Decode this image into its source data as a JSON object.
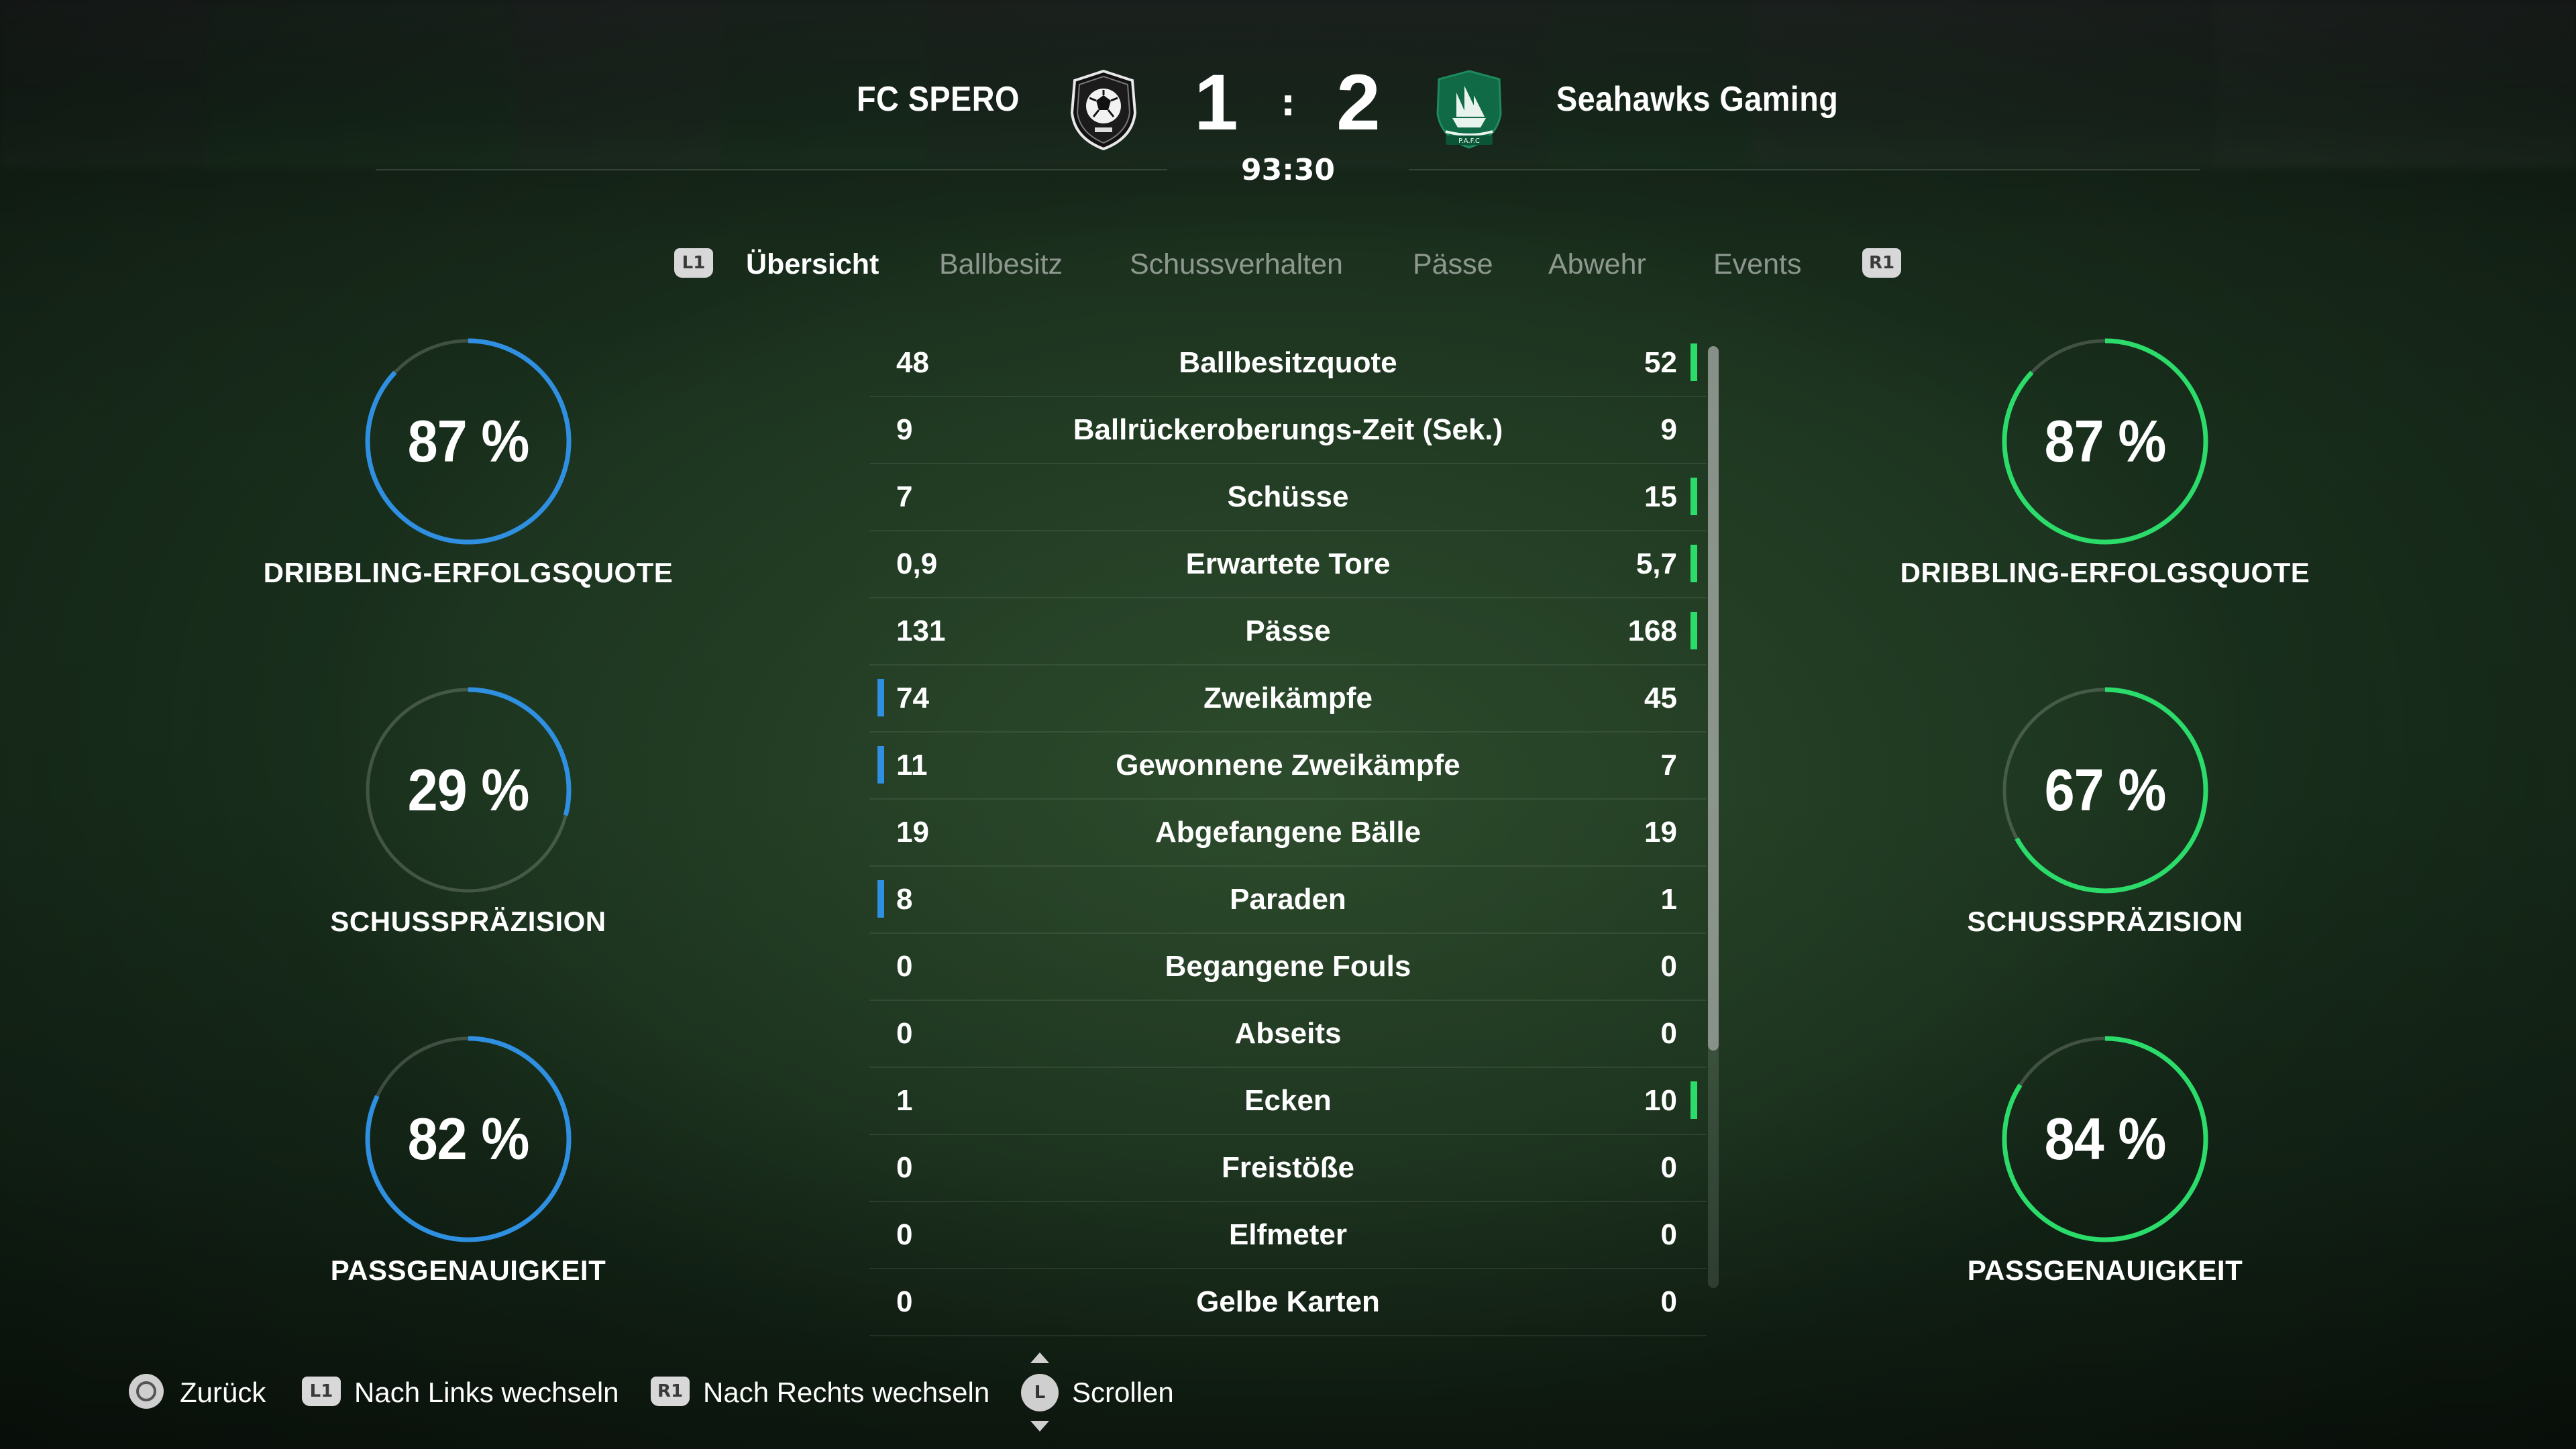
{
  "match": {
    "home_team": "FC SPERO",
    "away_team": "Seahawks Gaming",
    "home_score": "1",
    "away_score": "2",
    "separator": ":",
    "time": "93:30",
    "home_crest_icon": "club-crest-soccer-ball-icon",
    "away_crest_icon": "club-crest-ship-icon",
    "home_color": "#2f8fe0",
    "away_color": "#2bdc6a"
  },
  "tabs": {
    "left_button": "L1",
    "right_button": "R1",
    "items": [
      {
        "label": "Übersicht",
        "active": true
      },
      {
        "label": "Ballbesitz",
        "active": false
      },
      {
        "label": "Schussverhalten",
        "active": false
      },
      {
        "label": "Pässe",
        "active": false
      },
      {
        "label": "Abwehr",
        "active": false
      },
      {
        "label": "Events",
        "active": false
      }
    ]
  },
  "home_gauges": [
    {
      "value": "87 %",
      "fraction": 0.87,
      "label": "DRIBBLING-ERFOLGSQUOTE"
    },
    {
      "value": "29 %",
      "fraction": 0.29,
      "label": "SCHUSSPRÄZISION"
    },
    {
      "value": "82 %",
      "fraction": 0.82,
      "label": "PASSGENAUIGKEIT"
    }
  ],
  "away_gauges": [
    {
      "value": "87 %",
      "fraction": 0.87,
      "label": "DRIBBLING-ERFOLGSQUOTE"
    },
    {
      "value": "67 %",
      "fraction": 0.67,
      "label": "SCHUSSPRÄZISION"
    },
    {
      "value": "84 %",
      "fraction": 0.84,
      "label": "PASSGENAUIGKEIT"
    }
  ],
  "stats": [
    {
      "home": "48",
      "label": "Ballbesitzquote",
      "away": "52",
      "leader": "away"
    },
    {
      "home": "9",
      "label": "Ballrückeroberungs-Zeit (Sek.)",
      "away": "9",
      "leader": "none"
    },
    {
      "home": "7",
      "label": "Schüsse",
      "away": "15",
      "leader": "away"
    },
    {
      "home": "0,9",
      "label": "Erwartete Tore",
      "away": "5,7",
      "leader": "away"
    },
    {
      "home": "131",
      "label": "Pässe",
      "away": "168",
      "leader": "away"
    },
    {
      "home": "74",
      "label": "Zweikämpfe",
      "away": "45",
      "leader": "home"
    },
    {
      "home": "11",
      "label": "Gewonnene Zweikämpfe",
      "away": "7",
      "leader": "home"
    },
    {
      "home": "19",
      "label": "Abgefangene Bälle",
      "away": "19",
      "leader": "none"
    },
    {
      "home": "8",
      "label": "Paraden",
      "away": "1",
      "leader": "home"
    },
    {
      "home": "0",
      "label": "Begangene Fouls",
      "away": "0",
      "leader": "none"
    },
    {
      "home": "0",
      "label": "Abseits",
      "away": "0",
      "leader": "none"
    },
    {
      "home": "1",
      "label": "Ecken",
      "away": "10",
      "leader": "away"
    },
    {
      "home": "0",
      "label": "Freistöße",
      "away": "0",
      "leader": "none"
    },
    {
      "home": "0",
      "label": "Elfmeter",
      "away": "0",
      "leader": "none"
    },
    {
      "home": "0",
      "label": "Gelbe Karten",
      "away": "0",
      "leader": "none"
    }
  ],
  "footer": {
    "back_label": "Zurück",
    "left_button": "L1",
    "left_label": "Nach Links wechseln",
    "right_button": "R1",
    "right_label": "Nach Rechts wechseln",
    "stick_button": "L",
    "scroll_label": "Scrollen"
  }
}
